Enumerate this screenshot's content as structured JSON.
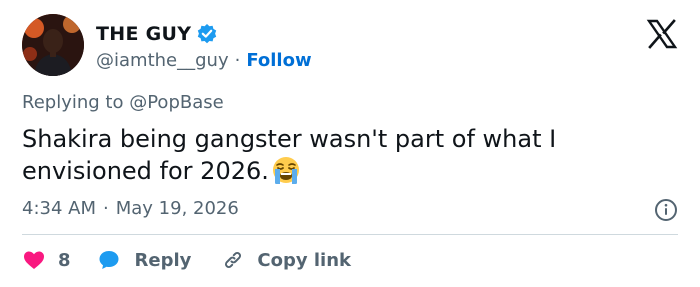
{
  "author": {
    "name": "THE GUY",
    "handle": "@iamthe__guy",
    "separator": "·",
    "follow_label": "Follow"
  },
  "reply_context": {
    "prefix": "Replying to",
    "target": "@PopBase"
  },
  "tweet": {
    "text": "Shakira being gangster wasn't part of what I envisioned for 2026.",
    "emoji": "loudly-crying-face"
  },
  "meta": {
    "time": "4:34 AM",
    "separator": "·",
    "date": "May 19, 2026"
  },
  "actions": {
    "like_count": "8",
    "reply_label": "Reply",
    "copy_label": "Copy link"
  },
  "colors": {
    "accent": "#006fd6",
    "like": "#f91880",
    "reply": "#1d9bf0",
    "muted": "#536471",
    "divider": "#cfd9de"
  },
  "icons": [
    "avatar-photo",
    "verified-badge-icon",
    "x-logo-icon",
    "loudly-crying-face-emoji",
    "info-icon",
    "heart-icon",
    "reply-bubble-icon",
    "link-icon"
  ]
}
